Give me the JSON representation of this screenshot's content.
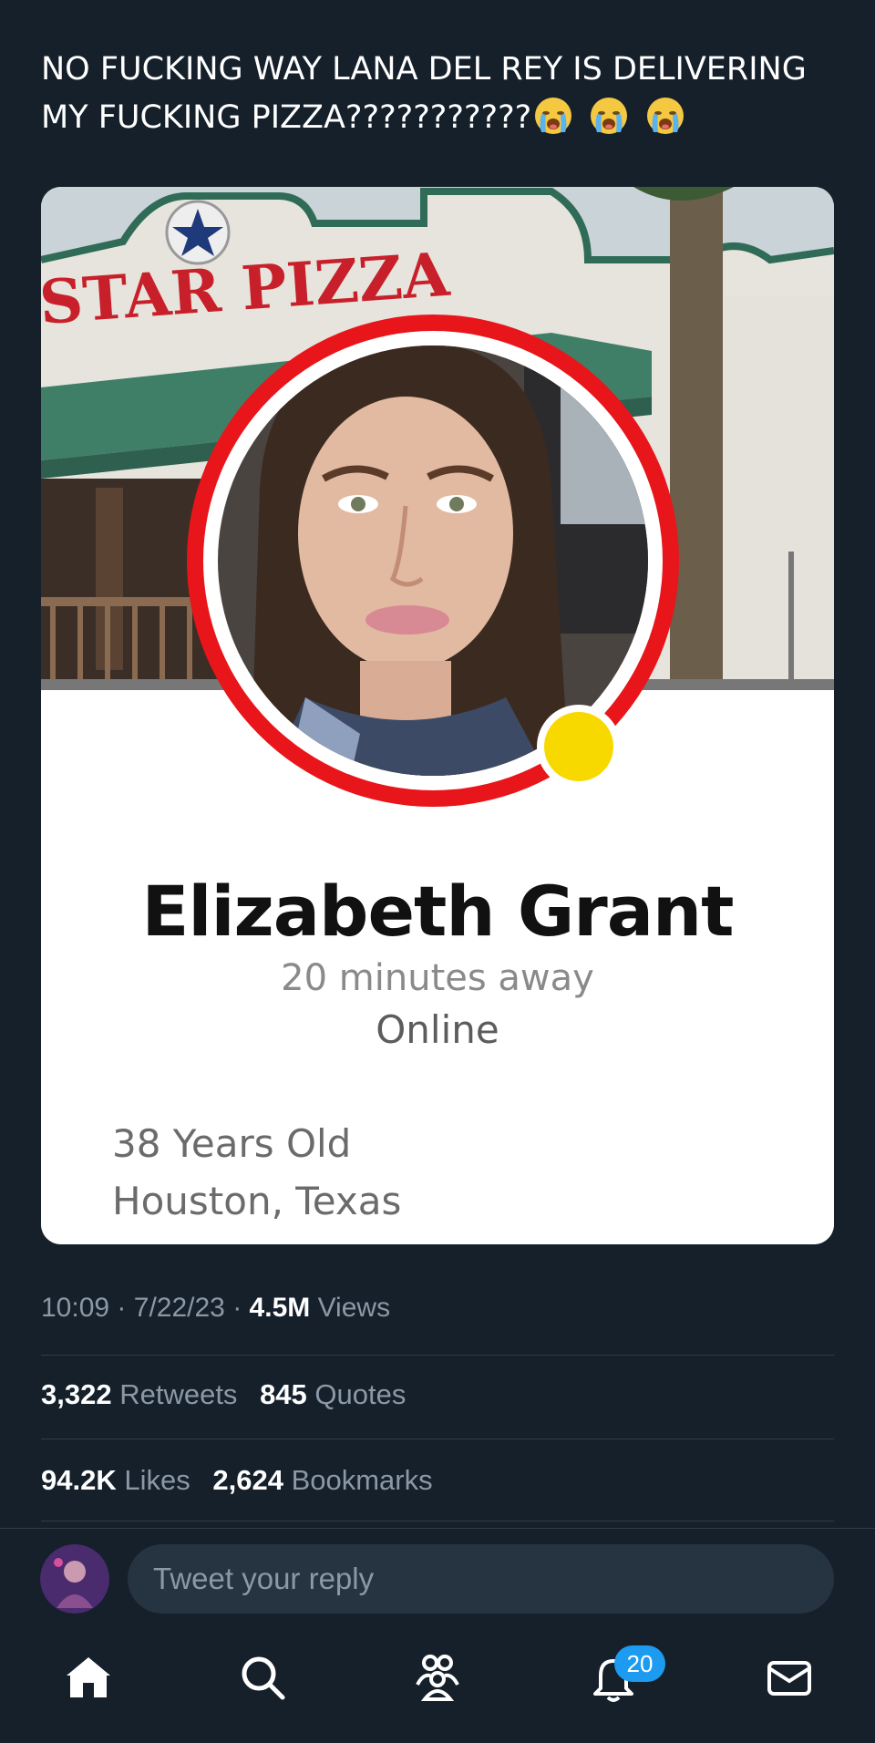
{
  "tweet": {
    "text": "NO FUCKING WAY LANA DEL REY IS DELIVERING MY FUCKING PIZZA???????????",
    "emoji_name": "loudly-crying-face",
    "emoji_count": 3
  },
  "media": {
    "sign_text": "STAR PIZZA",
    "profile": {
      "name": "Elizabeth Grant",
      "distance": "20 minutes away",
      "status": "Online",
      "age": "38 Years Old",
      "location": "Houston, Texas"
    },
    "colors": {
      "ring": "#e8151b",
      "status_dot": "#f7d900"
    }
  },
  "meta": {
    "time": "10:09",
    "date": "7/22/23",
    "views_count": "4.5M",
    "views_label": "Views",
    "separator": "·"
  },
  "stats": {
    "retweets_count": "3,322",
    "retweets_label": "Retweets",
    "quotes_count": "845",
    "quotes_label": "Quotes",
    "likes_count": "94.2K",
    "likes_label": "Likes",
    "bookmarks_count": "2,624",
    "bookmarks_label": "Bookmarks"
  },
  "reply": {
    "placeholder": "Tweet your reply"
  },
  "nav": {
    "items": [
      "home-icon",
      "search-icon",
      "communities-icon",
      "notifications-icon",
      "messages-icon"
    ],
    "notifications_badge": "20"
  },
  "theme": {
    "background": "#15202b",
    "accent": "#1d9bf0"
  }
}
